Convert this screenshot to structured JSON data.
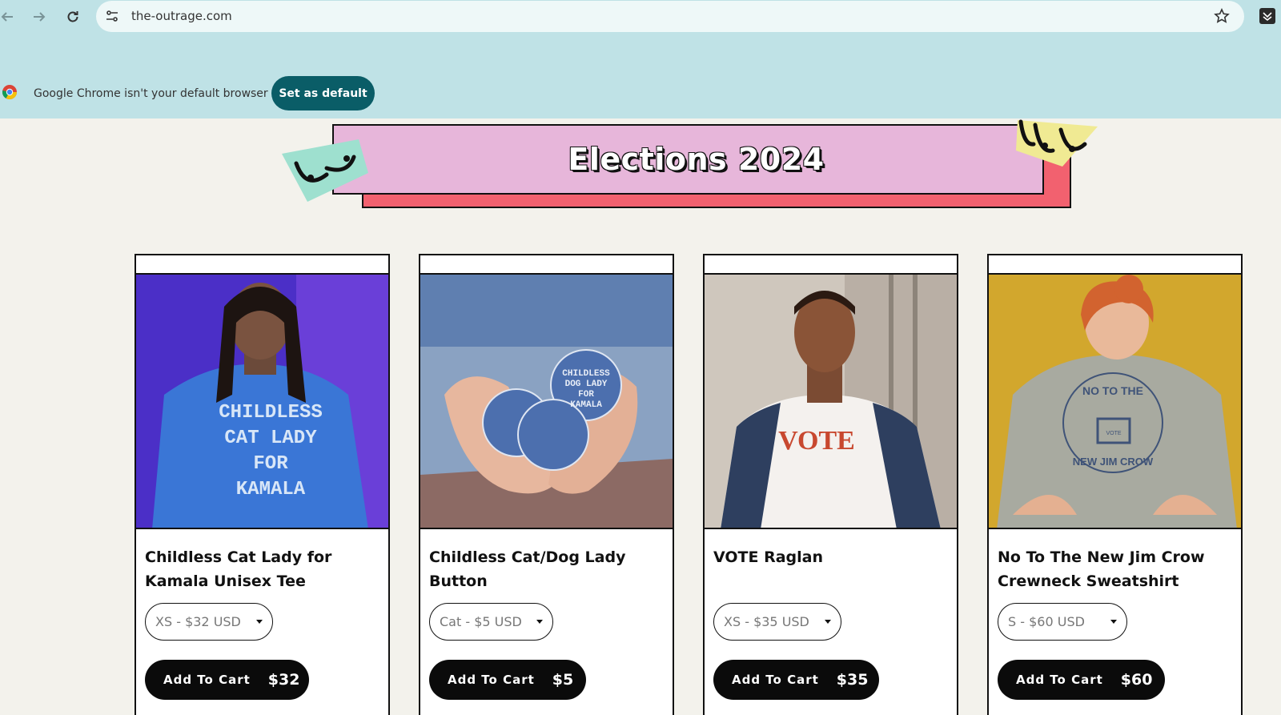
{
  "browser": {
    "url": "the-outrage.com",
    "infobar_text": "Google Chrome isn't your default browser",
    "set_default_label": "Set as default"
  },
  "banner": {
    "title": "Elections 2024"
  },
  "products": [
    {
      "title": "Childless Cat Lady for Kamala Unisex Tee",
      "variant": "XS - $32 USD",
      "cart_label": "Add To Cart",
      "price": "$32",
      "photo_text": [
        "CHILDLESS",
        "CAT LADY",
        "FOR",
        "KAMALA"
      ]
    },
    {
      "title": "Childless Cat/Dog Lady Button",
      "variant": "Cat - $5 USD",
      "cart_label": "Add To Cart",
      "price": "$5",
      "photo_text": [
        "CHILDLESS",
        "DOG LADY",
        "FOR",
        "KAMALA"
      ]
    },
    {
      "title": "VOTE Raglan",
      "variant": "XS - $35 USD",
      "cart_label": "Add To Cart",
      "price": "$35",
      "photo_text": [
        "VOTE"
      ]
    },
    {
      "title": "No To The New Jim Crow Crewneck Sweatshirt",
      "variant": "S - $60 USD",
      "cart_label": "Add To Cart",
      "price": "$60",
      "photo_text": [
        "NO TO THE",
        "NEW JIM CROW",
        "VOTE"
      ]
    }
  ],
  "colors": {
    "chrome_bg": "#bfe2e6",
    "page_bg": "#f3f2ec",
    "banner_pink": "#e7b6da",
    "banner_red": "#f2616f",
    "button_teal": "#0a5d67"
  }
}
